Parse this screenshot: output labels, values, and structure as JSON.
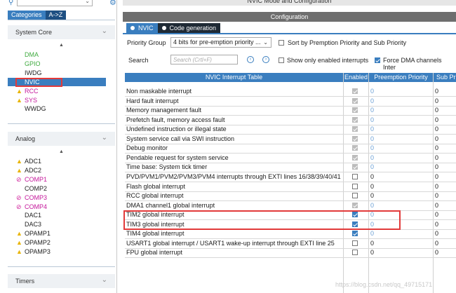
{
  "left": {
    "tabs": [
      "Categories",
      "A->Z"
    ],
    "sections": {
      "system_core": "System Core",
      "analog": "Analog",
      "timers": "Timers"
    },
    "system_core_items": [
      {
        "label": "DMA",
        "style": "green",
        "icon": ""
      },
      {
        "label": "GPIO",
        "style": "green",
        "icon": ""
      },
      {
        "label": "IWDG",
        "style": "normal",
        "icon": ""
      },
      {
        "label": "NVIC",
        "style": "selected",
        "icon": ""
      },
      {
        "label": "RCC",
        "style": "magenta",
        "icon": "warning-icon"
      },
      {
        "label": "SYS",
        "style": "magenta",
        "icon": "warning-icon"
      },
      {
        "label": "WWDG",
        "style": "normal",
        "icon": ""
      }
    ],
    "analog_items": [
      {
        "label": "ADC1",
        "style": "normal",
        "icon": "warning-icon"
      },
      {
        "label": "ADC2",
        "style": "normal",
        "icon": "warning-icon"
      },
      {
        "label": "COMP1",
        "style": "magenta",
        "icon": "disabled-icon"
      },
      {
        "label": "COMP2",
        "style": "normal",
        "icon": ""
      },
      {
        "label": "COMP3",
        "style": "magenta",
        "icon": "disabled-icon"
      },
      {
        "label": "COMP4",
        "style": "magenta",
        "icon": "disabled-icon"
      },
      {
        "label": "DAC1",
        "style": "normal",
        "icon": ""
      },
      {
        "label": "DAC3",
        "style": "normal",
        "icon": ""
      },
      {
        "label": "OPAMP1",
        "style": "normal",
        "icon": "warning-icon"
      },
      {
        "label": "OPAMP2",
        "style": "normal",
        "icon": "warning-icon"
      },
      {
        "label": "OPAMP3",
        "style": "normal",
        "icon": "warning-icon"
      }
    ]
  },
  "right": {
    "title": "NVIC Mode and Configuration",
    "config_header": "Configuration",
    "tabs": [
      "NVIC",
      "Code generation"
    ],
    "priority_group_label": "Priority Group",
    "priority_group_value": "4 bits for pre-emption priority ...",
    "sort_label": "Sort by Premption Priority and Sub Priority",
    "search_label": "Search",
    "search_placeholder": "Search (Crtl+F)",
    "show_enabled_label": "Show only enabled interrupts",
    "force_dma_label": "Force DMA channels Inter",
    "table_headers": [
      "NVIC Interrupt Table",
      "Enabled",
      "Preemption Priority",
      "Sub Pr"
    ],
    "rows": [
      {
        "name": "Non maskable interrupt",
        "enabled": "locked",
        "pre": "0",
        "sub": "0"
      },
      {
        "name": "Hard fault interrupt",
        "enabled": "locked",
        "pre": "0",
        "sub": "0"
      },
      {
        "name": "Memory management fault",
        "enabled": "locked",
        "pre": "0",
        "sub": "0"
      },
      {
        "name": "Prefetch fault, memory access fault",
        "enabled": "locked",
        "pre": "0",
        "sub": "0"
      },
      {
        "name": "Undefined instruction or illegal state",
        "enabled": "locked",
        "pre": "0",
        "sub": "0"
      },
      {
        "name": "System service call via SWI instruction",
        "enabled": "locked",
        "pre": "0",
        "sub": "0"
      },
      {
        "name": "Debug monitor",
        "enabled": "locked",
        "pre": "0",
        "sub": "0"
      },
      {
        "name": "Pendable request for system service",
        "enabled": "locked",
        "pre": "0",
        "sub": "0"
      },
      {
        "name": "Time base: System tick timer",
        "enabled": "locked",
        "pre": "0",
        "sub": "0"
      },
      {
        "name": "PVD/PVM1/PVM2/PVM3/PVM4 interrupts through EXTI lines 16/38/39/40/41",
        "enabled": "off",
        "pre": "0",
        "sub": "0"
      },
      {
        "name": "Flash global interrupt",
        "enabled": "off",
        "pre": "0",
        "sub": "0"
      },
      {
        "name": "RCC global interrupt",
        "enabled": "off",
        "pre": "0",
        "sub": "0"
      },
      {
        "name": "DMA1 channel1 global interrupt",
        "enabled": "locked",
        "pre": "0",
        "sub": "0"
      },
      {
        "name": "TIM2 global interrupt",
        "enabled": "on",
        "pre": "0",
        "sub": "0"
      },
      {
        "name": "TIM3 global interrupt",
        "enabled": "on",
        "pre": "0",
        "sub": "0"
      },
      {
        "name": "TIM4 global interrupt",
        "enabled": "on",
        "pre": "0",
        "sub": "0"
      },
      {
        "name": "USART1 global interrupt / USART1 wake-up interrupt through EXTI line 25",
        "enabled": "off",
        "pre": "0",
        "sub": "0"
      },
      {
        "name": "FPU global interrupt",
        "enabled": "off",
        "pre": "0",
        "sub": "0"
      }
    ]
  },
  "watermark": "https://blog.csdn.net/qq_49715171",
  "colors": {
    "accent": "#3a7ebf",
    "highlight_box": "#e23a3a",
    "warning": "#e8b400",
    "error": "#d0219c",
    "ok": "#3faa3f"
  }
}
